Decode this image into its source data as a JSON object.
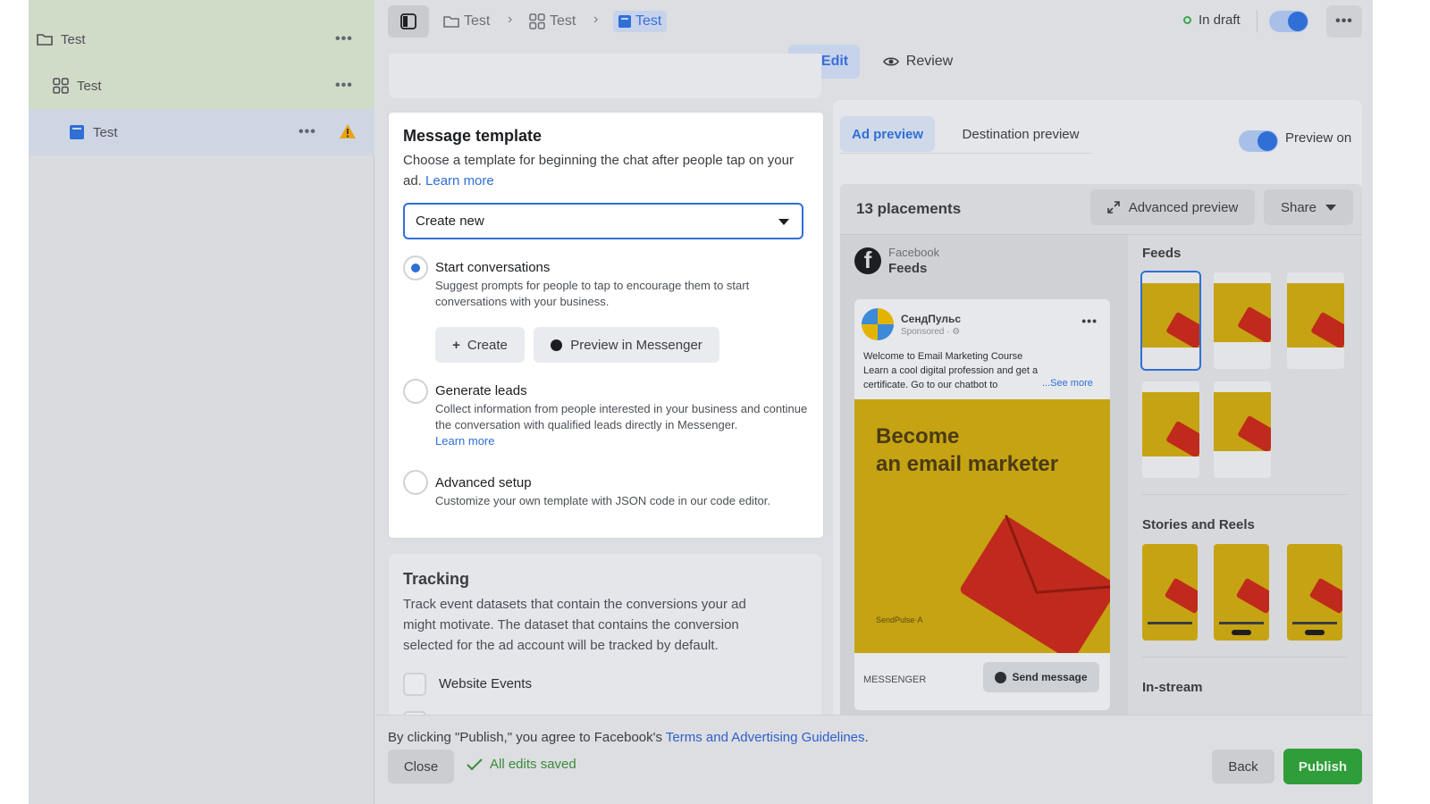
{
  "tree": {
    "items": [
      {
        "label": "Test",
        "icon": "folder-icon"
      },
      {
        "label": "Test",
        "icon": "grid-icon"
      },
      {
        "label": "Test",
        "icon": "ad-icon"
      }
    ],
    "more": "•••"
  },
  "breadcrumb": [
    "Test",
    "Test",
    "Test"
  ],
  "status": {
    "label": "In draft",
    "color": "#3aa64a"
  },
  "top_more": "•••",
  "mode_tabs": {
    "edit": "Edit",
    "review": "Review"
  },
  "message_template": {
    "title": "Message template",
    "description": "Choose a template for beginning the chat after people tap on your ad.",
    "learn_more": "Learn more",
    "select_value": "Create new",
    "options": [
      {
        "title": "Start conversations",
        "description": "Suggest prompts for people to tap to encourage them to start conversations with your business.",
        "selected": true
      },
      {
        "title": "Generate leads",
        "description": "Collect information from people interested in your business and continue the conversation with qualified leads directly in Messenger.",
        "learn_more": "Learn more",
        "selected": false
      },
      {
        "title": "Advanced setup",
        "description": "Customize your own template with JSON code in our code editor.",
        "selected": false
      }
    ],
    "create_label": "Create",
    "preview_messenger_label": "Preview in Messenger"
  },
  "tracking": {
    "title": "Tracking",
    "description": "Track event datasets that contain the conversions your ad might motivate. The dataset that contains the conversion selected for the ad account will be tracked by default.",
    "website_events": "Website Events"
  },
  "preview": {
    "tab_ad": "Ad preview",
    "tab_destination": "Destination preview",
    "preview_on": "Preview on",
    "placements_count": "13 placements",
    "advanced_preview": "Advanced preview",
    "share": "Share",
    "platform": "Facebook",
    "placement": "Feeds",
    "post": {
      "page_name": "СендПульс",
      "sponsored": "Sponsored · ⚙",
      "text_line1": "Welcome to Email Marketing Course",
      "text_line2": "Learn a cool digital profession and get a",
      "text_line3": "certificate. Go to our chatbot to",
      "see_more": "...See more",
      "headline_line1": "Become",
      "headline_line2": "an email marketer",
      "brand": "SendPulse·A",
      "footer_label": "MESSENGER",
      "cta": "Send message"
    },
    "sections": {
      "feeds": "Feeds",
      "stories": "Stories and Reels",
      "instream": "In-stream"
    }
  },
  "footer": {
    "terms_prefix": "By clicking \"Publish,\" you agree to Facebook's ",
    "terms_link": "Terms and Advertising Guidelines",
    "terms_suffix": ".",
    "close": "Close",
    "saved": "All edits saved",
    "back": "Back",
    "publish": "Publish"
  },
  "colors": {
    "accent": "#2f6fd6",
    "publish": "#2f9d3a",
    "warning": "#e8a317"
  }
}
